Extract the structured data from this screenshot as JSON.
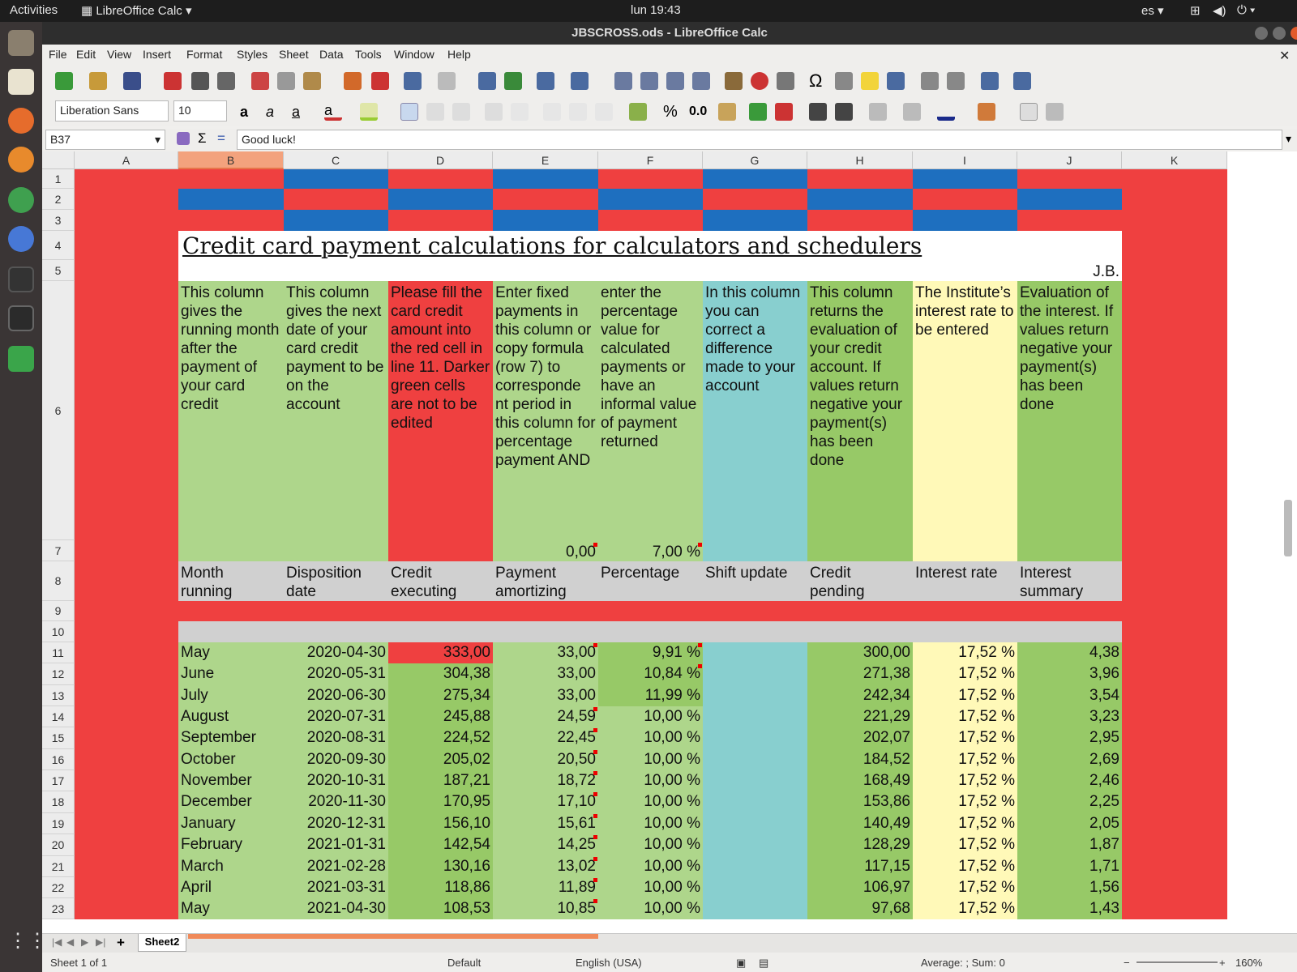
{
  "system": {
    "activities": "Activities",
    "app": "LibreOffice Calc",
    "clock": "lun 19:43",
    "lang": "es"
  },
  "window": {
    "title": "JBSCROSS.ods - LibreOffice Calc"
  },
  "menu": [
    "File",
    "Edit",
    "View",
    "Insert",
    "Format",
    "Styles",
    "Sheet",
    "Data",
    "Tools",
    "Window",
    "Help"
  ],
  "toolbar": {
    "font_name": "Liberation Sans",
    "font_size": "10",
    "percent": "%",
    "decimal": "0.0"
  },
  "formula": {
    "cell_ref": "B37",
    "content": "Good luck!",
    "sigma": "Σ",
    "equals": "="
  },
  "columns": [
    "A",
    "B",
    "C",
    "D",
    "E",
    "F",
    "G",
    "H",
    "I",
    "J",
    "K"
  ],
  "rows": [
    "1",
    "2",
    "3",
    "4",
    "5",
    "6",
    "7",
    "8",
    "9",
    "10",
    "11",
    "12",
    "13",
    "14",
    "15",
    "16",
    "17",
    "18",
    "19",
    "20",
    "21",
    "22",
    "23"
  ],
  "sheet": {
    "title": "Credit card payment calculations for calculators and schedulers",
    "author": "J.B.",
    "descriptions": [
      "This column gives the running month after the payment of your card credit",
      "This column gives the next date of your card credit payment to be on the account",
      "Please fill the card credit amount into the red cell in line 11. Darker green cells are not to be edited",
      "Enter fixed payments in this column or copy formula (row 7) to corresponde nt period in this column for percentage payment AND",
      "enter the percentage value for calculated payments  or have an informal value of payment returned",
      "In this column you can correct a difference made to your account",
      "This column returns the evaluation of your credit account. If values return negative your payment(s) has been done",
      "The Institute’s interest rate to be entered",
      "Evaluation of the interest. If values return negative your payment(s) has been done"
    ],
    "row7": {
      "payment": "0,00",
      "percentage": "7,00 %"
    },
    "headers": [
      [
        "Month",
        "running"
      ],
      [
        "Disposition",
        "date"
      ],
      [
        "Credit",
        "executing"
      ],
      [
        "Payment",
        "amortizing"
      ],
      [
        "Percentage",
        ""
      ],
      [
        "Shift update",
        ""
      ],
      [
        "Credit",
        "pending"
      ],
      [
        "Interest rate",
        ""
      ],
      [
        "Interest",
        "summary"
      ]
    ],
    "data": [
      [
        "May",
        "2020-04-30",
        "333,00",
        "33,00",
        "9,91 %",
        "",
        "300,00",
        "17,52 %",
        "4,38"
      ],
      [
        "June",
        "2020-05-31",
        "304,38",
        "33,00",
        "10,84 %",
        "",
        "271,38",
        "17,52 %",
        "3,96"
      ],
      [
        "July",
        "2020-06-30",
        "275,34",
        "33,00",
        "11,99 %",
        "",
        "242,34",
        "17,52 %",
        "3,54"
      ],
      [
        "August",
        "2020-07-31",
        "245,88",
        "24,59",
        "10,00 %",
        "",
        "221,29",
        "17,52 %",
        "3,23"
      ],
      [
        "September",
        "2020-08-31",
        "224,52",
        "22,45",
        "10,00 %",
        "",
        "202,07",
        "17,52 %",
        "2,95"
      ],
      [
        "October",
        "2020-09-30",
        "205,02",
        "20,50",
        "10,00 %",
        "",
        "184,52",
        "17,52 %",
        "2,69"
      ],
      [
        "November",
        "2020-10-31",
        "187,21",
        "18,72",
        "10,00 %",
        "",
        "168,49",
        "17,52 %",
        "2,46"
      ],
      [
        "December",
        "2020-11-30",
        "170,95",
        "17,10",
        "10,00 %",
        "",
        "153,86",
        "17,52 %",
        "2,25"
      ],
      [
        "January",
        "2020-12-31",
        "156,10",
        "15,61",
        "10,00 %",
        "",
        "140,49",
        "17,52 %",
        "2,05"
      ],
      [
        "February",
        "2021-01-31",
        "142,54",
        "14,25",
        "10,00 %",
        "",
        "128,29",
        "17,52 %",
        "1,87"
      ],
      [
        "March",
        "2021-02-28",
        "130,16",
        "13,02",
        "10,00 %",
        "",
        "117,15",
        "17,52 %",
        "1,71"
      ],
      [
        "April",
        "2021-03-31",
        "118,86",
        "11,89",
        "10,00 %",
        "",
        "106,97",
        "17,52 %",
        "1,56"
      ],
      [
        "May",
        "2021-04-30",
        "108,53",
        "10,85",
        "10,00 %",
        "",
        "97,68",
        "17,52 %",
        "1,43"
      ]
    ]
  },
  "tabs": {
    "sheet_tab": "Sheet2"
  },
  "status": {
    "sheet": "Sheet 1 of 1",
    "style": "Default",
    "language": "English (USA)",
    "summary": "Average: ; Sum: 0",
    "zoom": "160%"
  },
  "colors": {
    "red": "#ef4040",
    "blue": "#1e6fbf",
    "light_green": "#aed68b",
    "dark_green": "#97c967",
    "teal": "#88cfcf",
    "yellow": "#fff9b8",
    "gray": "#d0d0d0"
  }
}
